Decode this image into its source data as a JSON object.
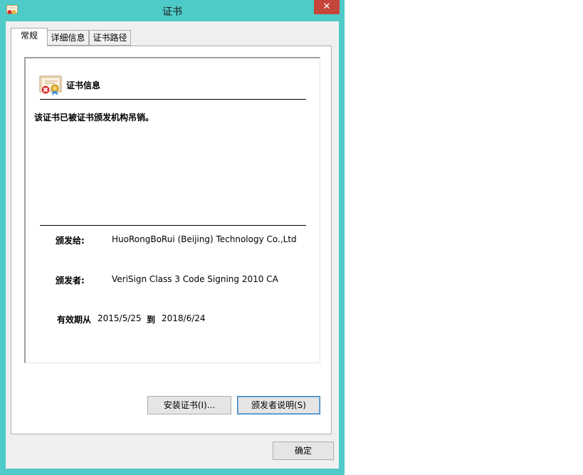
{
  "window": {
    "title": "证书",
    "close_glyph": "✕"
  },
  "tabs": [
    {
      "label": "常规"
    },
    {
      "label": "详细信息"
    },
    {
      "label": "证书路径"
    }
  ],
  "general": {
    "info_title": "证书信息",
    "status_message": "该证书已被证书颁发机构吊销。",
    "issued_to_label": "颁发给:",
    "issued_to_value": "HuoRongBoRui (Beijing) Technology Co.,Ltd",
    "issued_by_label": "颁发者:",
    "issued_by_value": "VeriSign Class 3 Code Signing 2010 CA",
    "valid_label": "有效期从",
    "valid_from": "2015/5/25",
    "valid_to_label": "到",
    "valid_to": "2018/6/24"
  },
  "buttons": {
    "install": "安装证书(I)...",
    "issuer_statement": "颁发者说明(S)",
    "ok": "确定"
  },
  "colors": {
    "frame": "#4ecbc8",
    "close": "#c7463b",
    "revoked_x": "#d9302c"
  },
  "icons": {
    "app": "certificate-icon",
    "cert": "revoked-certificate-icon"
  }
}
